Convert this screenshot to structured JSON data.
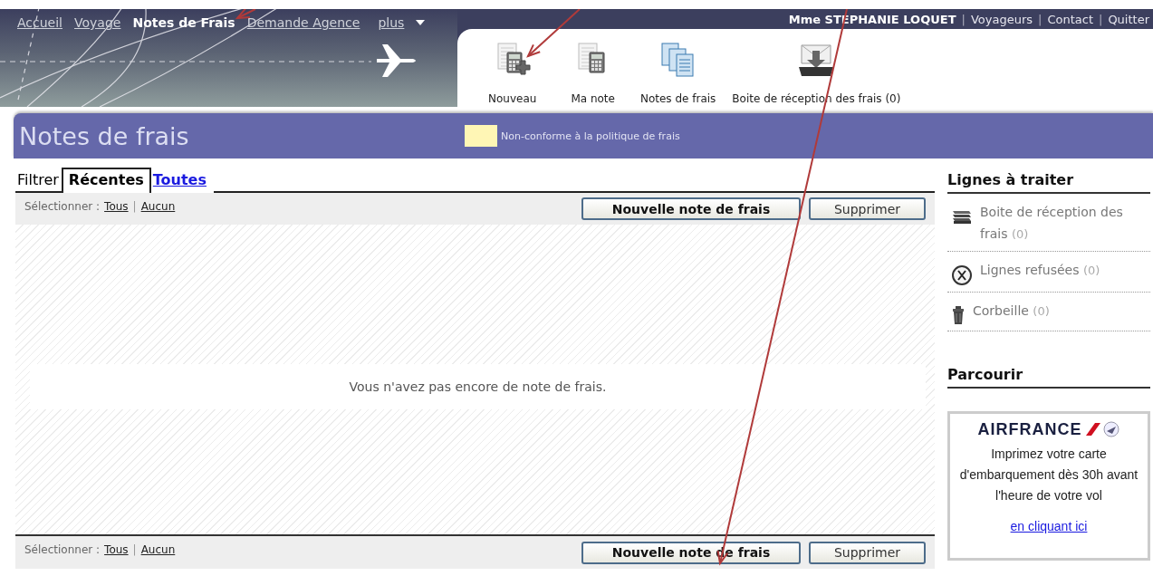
{
  "nav": {
    "links": [
      {
        "label": "Accueil",
        "selected": false
      },
      {
        "label": "Voyage",
        "selected": false
      },
      {
        "label": "Notes de Frais",
        "selected": true
      },
      {
        "label": "Demande Agence",
        "selected": false
      }
    ],
    "more": "plus"
  },
  "user": {
    "name": "Mme STEPHANIE LOQUET",
    "separator": "|",
    "links": [
      "Voyageurs",
      "Contact",
      "Quitter"
    ]
  },
  "toolbar": [
    {
      "kind": "new",
      "label": "Nouveau"
    },
    {
      "kind": "note",
      "label": "Ma note"
    },
    {
      "kind": "notes",
      "label": "Notes de frais"
    },
    {
      "kind": "inbox",
      "label": "Boite de réception des frais (0)"
    }
  ],
  "page_title": "Notes de frais",
  "legend": {
    "label": "Non-conforme à la politique de frais"
  },
  "filter": {
    "label": "Filtrer",
    "tabs": [
      {
        "label": "Récentes",
        "selected": true
      },
      {
        "label": "Toutes",
        "selected": false
      }
    ]
  },
  "select_bars": [
    {
      "label": "Sélectionner :",
      "separator": "|",
      "links": [
        "Tous",
        "Aucun"
      ],
      "buttons": [
        {
          "label": "Nouvelle note de frais",
          "primary": true
        },
        {
          "label": "Supprimer",
          "primary": false
        }
      ]
    },
    {
      "label": "Sélectionner :",
      "separator": "|",
      "links": [
        "Tous",
        "Aucun"
      ],
      "buttons": [
        {
          "label": "Nouvelle note de frais",
          "primary": true
        },
        {
          "label": "Supprimer",
          "primary": false
        }
      ]
    }
  ],
  "empty_message": "Vous n'avez pas encore de note de frais.",
  "sidebar": {
    "title": "Lignes à traiter",
    "items": [
      {
        "kind": "trays",
        "label": "Boite de réception des frais",
        "count": "(0)"
      },
      {
        "kind": "refused",
        "label": "Lignes refusées",
        "count": "(0)"
      },
      {
        "kind": "trash",
        "label": "Corbeille",
        "count": "(0)"
      }
    ],
    "browse_title": "Parcourir",
    "ad": {
      "logo": "AIRFRANCE",
      "text": "Imprimez votre carte d'embarquement dès 30h avant l'heure de votre vol",
      "link": "en cliquant ici"
    }
  }
}
